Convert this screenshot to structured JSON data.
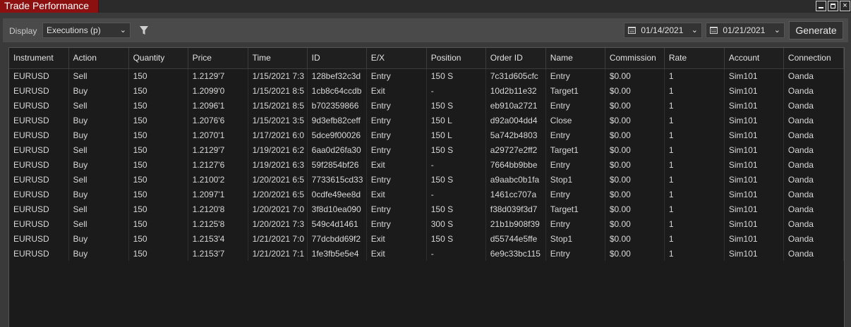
{
  "window": {
    "title": "Trade Performance",
    "min_label": "",
    "max_label": "",
    "close_label": "×"
  },
  "toolbar": {
    "display_label": "Display",
    "display_value": "Executions (p)",
    "from_date": "01/14/2021",
    "to_date": "01/21/2021",
    "generate_label": "Generate"
  },
  "columns": [
    "Instrument",
    "Action",
    "Quantity",
    "Price",
    "Time",
    "ID",
    "E/X",
    "Position",
    "Order ID",
    "Name",
    "Commission",
    "Rate",
    "Account",
    "Connection"
  ],
  "rows": [
    [
      "EURUSD",
      "Sell",
      "150",
      "1.2129'7",
      "1/15/2021 7:3",
      "128bef32c3d",
      "Entry",
      "150 S",
      "7c31d605cfc",
      "Entry",
      "$0.00",
      "1",
      "Sim101",
      "Oanda"
    ],
    [
      "EURUSD",
      "Buy",
      "150",
      "1.2099'0",
      "1/15/2021 8:5",
      "1cb8c64ccdb",
      "Exit",
      "-",
      "10d2b11e32",
      "Target1",
      "$0.00",
      "1",
      "Sim101",
      "Oanda"
    ],
    [
      "EURUSD",
      "Sell",
      "150",
      "1.2096'1",
      "1/15/2021 8:5",
      "b702359866",
      "Entry",
      "150 S",
      "eb910a2721",
      "Entry",
      "$0.00",
      "1",
      "Sim101",
      "Oanda"
    ],
    [
      "EURUSD",
      "Buy",
      "150",
      "1.2076'6",
      "1/15/2021 3:5",
      "9d3efb82ceff",
      "Entry",
      "150 L",
      "d92a004dd4",
      "Close",
      "$0.00",
      "1",
      "Sim101",
      "Oanda"
    ],
    [
      "EURUSD",
      "Buy",
      "150",
      "1.2070'1",
      "1/17/2021 6:0",
      "5dce9f00026",
      "Entry",
      "150 L",
      "5a742b4803",
      "Entry",
      "$0.00",
      "1",
      "Sim101",
      "Oanda"
    ],
    [
      "EURUSD",
      "Sell",
      "150",
      "1.2129'7",
      "1/19/2021 6:2",
      "6aa0d26fa30",
      "Entry",
      "150 S",
      "a29727e2ff2",
      "Target1",
      "$0.00",
      "1",
      "Sim101",
      "Oanda"
    ],
    [
      "EURUSD",
      "Buy",
      "150",
      "1.2127'6",
      "1/19/2021 6:3",
      "59f2854bf26",
      "Exit",
      "-",
      "7664bb9bbe",
      "Entry",
      "$0.00",
      "1",
      "Sim101",
      "Oanda"
    ],
    [
      "EURUSD",
      "Sell",
      "150",
      "1.2100'2",
      "1/20/2021 6:5",
      "7733615cd33",
      "Entry",
      "150 S",
      "a9aabc0b1fa",
      "Stop1",
      "$0.00",
      "1",
      "Sim101",
      "Oanda"
    ],
    [
      "EURUSD",
      "Buy",
      "150",
      "1.2097'1",
      "1/20/2021 6:5",
      "0cdfe49ee8d",
      "Exit",
      "-",
      "1461cc707a",
      "Entry",
      "$0.00",
      "1",
      "Sim101",
      "Oanda"
    ],
    [
      "EURUSD",
      "Sell",
      "150",
      "1.2120'8",
      "1/20/2021 7:0",
      "3f8d10ea090",
      "Entry",
      "150 S",
      "f38d039f3d7",
      "Target1",
      "$0.00",
      "1",
      "Sim101",
      "Oanda"
    ],
    [
      "EURUSD",
      "Sell",
      "150",
      "1.2125'8",
      "1/20/2021 7:3",
      "549c4d1461",
      "Entry",
      "300 S",
      "21b1b908f39",
      "Entry",
      "$0.00",
      "1",
      "Sim101",
      "Oanda"
    ],
    [
      "EURUSD",
      "Buy",
      "150",
      "1.2153'4",
      "1/21/2021 7:0",
      "77dcbdd69f2",
      "Exit",
      "150 S",
      "d55744e5ffe",
      "Stop1",
      "$0.00",
      "1",
      "Sim101",
      "Oanda"
    ],
    [
      "EURUSD",
      "Buy",
      "150",
      "1.2153'7",
      "1/21/2021 7:1",
      "1fe3fb5e5e4",
      "Exit",
      "-",
      "6e9c33bc115",
      "Entry",
      "$0.00",
      "1",
      "Sim101",
      "Oanda"
    ]
  ],
  "icons": {
    "filter": "filter-icon",
    "calendar": "calendar-icon",
    "dropdown": "chevron-down-icon"
  },
  "colors": {
    "title_tab": "#8c1010",
    "toolbar_bg": "#4a4a4a",
    "grid_bg": "#1b1b1b"
  }
}
